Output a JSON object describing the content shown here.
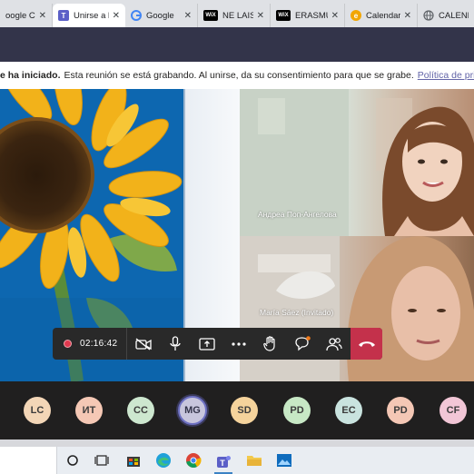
{
  "browser": {
    "tabs": [
      {
        "title": "oogle Ca",
        "favicon": "google-calendar-icon",
        "color": "#1a73e8",
        "active": false
      },
      {
        "title": "Unirse a la",
        "favicon": "teams-icon",
        "color": "#5b5fc7",
        "active": true
      },
      {
        "title": "Google",
        "favicon": "google-icon",
        "color": "#4285f4",
        "active": false
      },
      {
        "title": "NE LAISSE",
        "favicon": "wix-icon",
        "color": "#000000",
        "active": false
      },
      {
        "title": "ERASMUS",
        "favicon": "wix-icon",
        "color": "#000000",
        "active": false
      },
      {
        "title": "Calendario",
        "favicon": "calendar-icon",
        "color": "#f2a600",
        "active": false
      },
      {
        "title": "CALENDA",
        "favicon": "globe-icon",
        "color": "#5f6368",
        "active": false
      }
    ],
    "close_glyph": "✕"
  },
  "banner": {
    "bold_text": "e ha iniciado.",
    "text": "Esta reunión se está grabando. Al unirse, da su consentimiento para que se grabe.",
    "link": "Política de privacidad"
  },
  "participants_video": [
    {
      "name": "Андреа Поп-Ангелова"
    },
    {
      "name": "María Sáez (Invitado)"
    }
  ],
  "controls": {
    "timer": "02:16:42",
    "buttons": [
      "camera-off-icon",
      "microphone-icon",
      "share-screen-icon",
      "more-icon",
      "raise-hand-icon",
      "chat-icon",
      "participants-icon"
    ],
    "hangup": "hang-up-icon"
  },
  "roster": [
    {
      "initials": "LC",
      "color": "#f3d6b7"
    },
    {
      "initials": "ИТ",
      "color": "#f5c8b5"
    },
    {
      "initials": "CC",
      "color": "#cde7cf"
    },
    {
      "initials": "MG",
      "color": "#c8c6dd"
    },
    {
      "initials": "SD",
      "color": "#f5d39c"
    },
    {
      "initials": "PD",
      "color": "#c7e8c5"
    },
    {
      "initials": "EC",
      "color": "#c9e3df"
    },
    {
      "initials": "PD",
      "color": "#f4c7b5"
    },
    {
      "initials": "CF",
      "color": "#f2c6d6"
    }
  ],
  "taskbar": {
    "icons": [
      "search-icon",
      "task-view-icon",
      "store-icon",
      "edge-icon",
      "chrome-icon",
      "teams-icon",
      "file-explorer-icon",
      "photos-icon"
    ]
  },
  "colors": {
    "teams_header": "#33344a",
    "hangup": "#c4314b",
    "accent": "#6264a7"
  }
}
